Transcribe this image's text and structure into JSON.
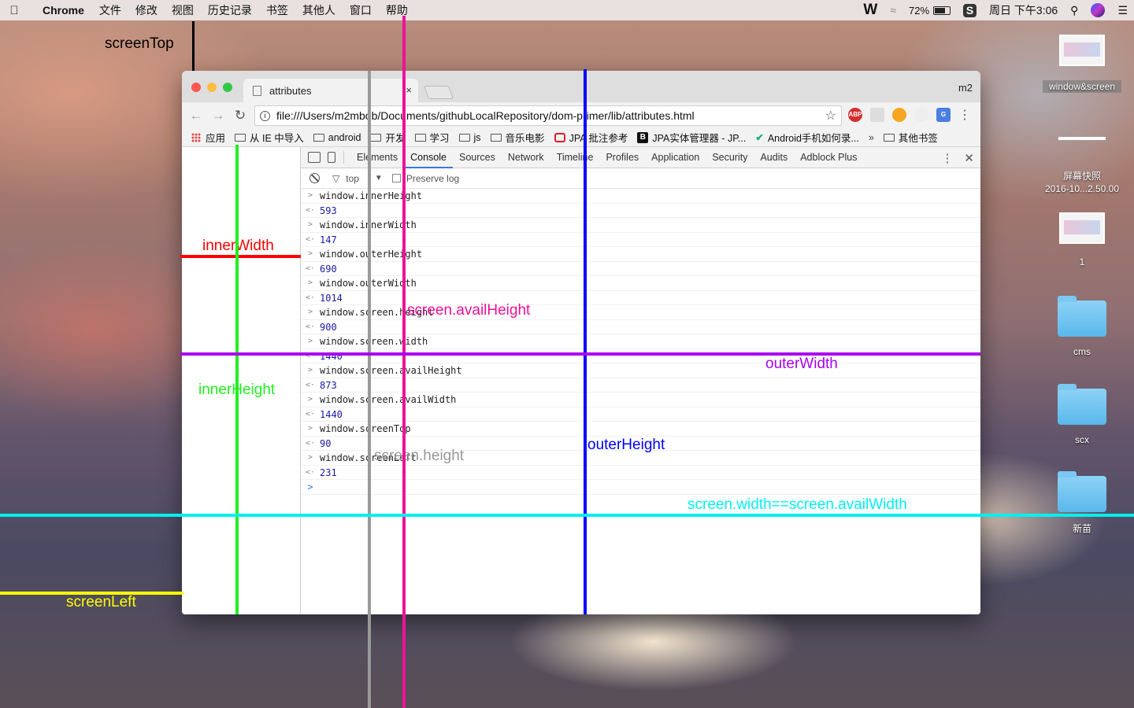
{
  "menubar": {
    "app": "Chrome",
    "items": [
      "文件",
      "修改",
      "视图",
      "历史记录",
      "书签",
      "其他人",
      "窗口",
      "帮助"
    ],
    "battery": "72%",
    "clock": "周日 下午3:06",
    "w_icon": "W",
    "s_icon": "S"
  },
  "browser": {
    "tab_title": "attributes",
    "tab_close": "×",
    "profile": "m2",
    "url": "file:///Users/m2mbob/Documents/githubLocalRepository/dom-primer/lib/attributes.html",
    "extensions": [
      "ABP",
      "",
      "",
      "",
      "G"
    ],
    "bookmarks": [
      {
        "icon": "apps-icon",
        "label": "应用"
      },
      {
        "icon": "folder-icon",
        "label": "从 IE 中导入"
      },
      {
        "icon": "folder-icon",
        "label": "android"
      },
      {
        "icon": "folder-icon",
        "label": "开发"
      },
      {
        "icon": "folder-icon",
        "label": "学习"
      },
      {
        "icon": "folder-icon",
        "label": "js"
      },
      {
        "icon": "folder-icon",
        "label": "音乐电影"
      },
      {
        "icon": "red-icon",
        "label": "JPA 批注参考"
      },
      {
        "icon": "b-icon",
        "label": "JPA实体管理器 - JP..."
      },
      {
        "icon": "t-icon",
        "label": "Android手机如何录..."
      }
    ],
    "bookmarks_more": "»",
    "other_bookmarks": "其他书签"
  },
  "devtools": {
    "tabs": [
      "Elements",
      "Console",
      "Sources",
      "Network",
      "Timeline",
      "Profiles",
      "Application",
      "Security",
      "Audits",
      "Adblock Plus"
    ],
    "selected_tab": "Console",
    "context": "top",
    "preserve_log": "Preserve log",
    "console_lines": [
      {
        "type": "in",
        "text": "window.innerHeight"
      },
      {
        "type": "out",
        "text": "593"
      },
      {
        "type": "in",
        "text": "window.innerWidth"
      },
      {
        "type": "out",
        "text": "147"
      },
      {
        "type": "in",
        "text": "window.outerHeight"
      },
      {
        "type": "out",
        "text": "690"
      },
      {
        "type": "in",
        "text": "window.outerWidth"
      },
      {
        "type": "out",
        "text": "1014"
      },
      {
        "type": "in",
        "text": "window.screen.height"
      },
      {
        "type": "out",
        "text": "900"
      },
      {
        "type": "in",
        "text": "window.screen.width"
      },
      {
        "type": "out",
        "text": "1440"
      },
      {
        "type": "in",
        "text": "window.screen.availHeight"
      },
      {
        "type": "out",
        "text": "873"
      },
      {
        "type": "in",
        "text": "window.screen.availWidth"
      },
      {
        "type": "out",
        "text": "1440"
      },
      {
        "type": "in",
        "text": "window.screenTop"
      },
      {
        "type": "out",
        "text": "90"
      },
      {
        "type": "in",
        "text": "window.screenLeft"
      },
      {
        "type": "out",
        "text": "231"
      }
    ]
  },
  "annotations": {
    "screenTop": "screenTop",
    "innerWidth": "innerWidth",
    "innerHeight": "innerHeight",
    "screenAvailHeight": "screen.availHeight",
    "outerWidth": "outerWidth",
    "outerHeight": "outerHeight",
    "screenHeight": "screen.height",
    "screenWidthEq": "screen.width==screen.availWidth",
    "screenLeft": "screenLeft",
    "colors": {
      "screenTop": "#000000",
      "innerWidth": "#ff0000",
      "innerHeight": "#22ee22",
      "screenAvailHeight": "#ee1199",
      "outerWidth": "#aa00ee",
      "outerHeight": "#0000ff",
      "screenHeight": "#999999",
      "screenWidthEq": "#00f0f0",
      "screenLeft": "#ffff00"
    }
  },
  "desktop": [
    {
      "icon": "screenshot-thumb-icon",
      "label": "window&screen"
    },
    {
      "icon": "line-thumb-icon",
      "label": ""
    },
    {
      "icon": "screenshot-thumb-icon",
      "label": "屏幕快照\n2016-10...2.50.00"
    },
    {
      "icon": "screenshot-thumb-icon",
      "label": "1"
    },
    {
      "icon": "folder-icon",
      "label": "cms"
    },
    {
      "icon": "folder-icon",
      "label": "scx"
    },
    {
      "icon": "folder-icon",
      "label": "新苗"
    }
  ]
}
